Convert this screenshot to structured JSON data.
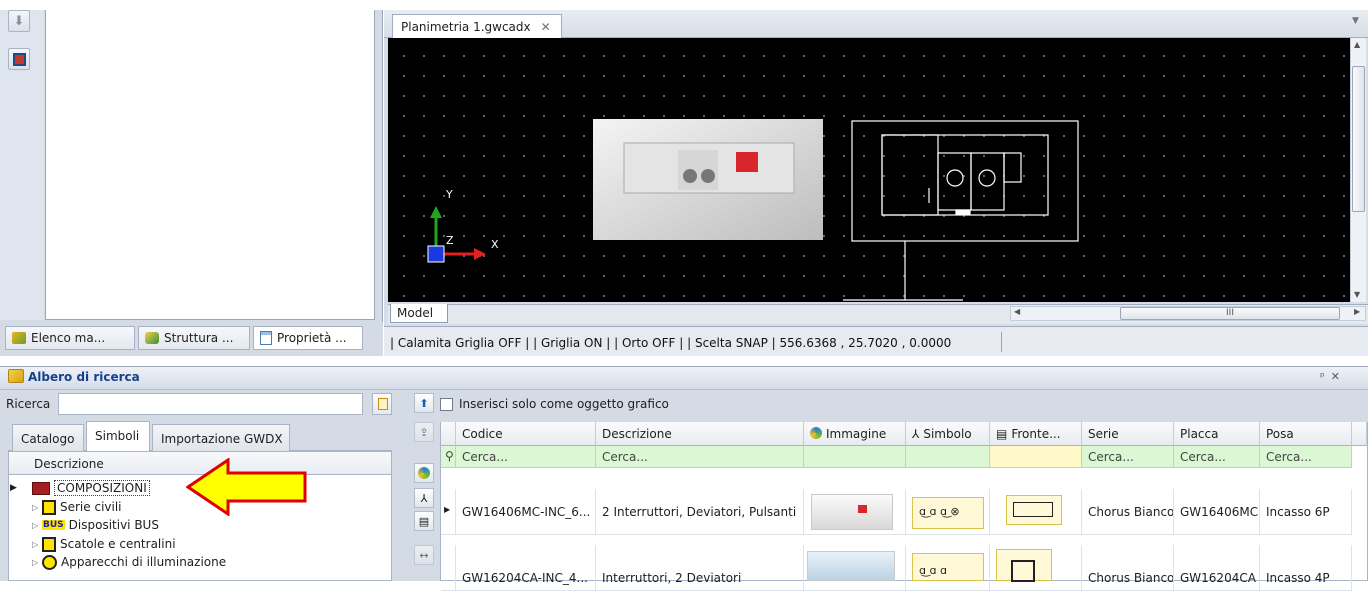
{
  "document": {
    "tab_title": "Planimetria 1.gwcadx",
    "model_tab": "Model",
    "scroll_label": "III",
    "axis_x": "X",
    "axis_y": "Y",
    "axis_z": "Z"
  },
  "status": {
    "text": "| Calamita Griglia OFF | | Griglia ON | | Orto OFF | | Scelta SNAP |   556.6368 , 25.7020 , 0.0000"
  },
  "left_tabs": [
    {
      "label": "Elenco ma...",
      "icon": "list-icon"
    },
    {
      "label": "Struttura ...",
      "icon": "structure-icon"
    },
    {
      "label": "Proprietà ...",
      "icon": "properties-icon"
    }
  ],
  "search_panel": {
    "title": "Albero di ricerca",
    "search_label": "Ricerca",
    "search_value": "",
    "tabs": [
      "Catalogo",
      "Simboli",
      "Importazione GWDX"
    ],
    "active_tab": "Simboli",
    "tree_header": "Descrizione",
    "tree_items": [
      {
        "label": "COMPOSIZIONI",
        "icon": "composition-icon",
        "selected": true
      },
      {
        "label": "Serie civili",
        "icon": "series-icon"
      },
      {
        "label": "Dispositivi BUS",
        "icon": "bus-icon",
        "badge": "BUS"
      },
      {
        "label": "Scatole e centralini",
        "icon": "box-icon"
      },
      {
        "label": "Apparecchi di illuminazione",
        "icon": "lamp-icon"
      }
    ]
  },
  "grid": {
    "checkbox_label": "Inserisci solo come oggetto grafico",
    "columns": [
      "Codice",
      "Descrizione",
      "Immagine",
      "Simbolo",
      "Fronte...",
      "Serie",
      "Placca",
      "Posa"
    ],
    "filter_placeholder": "Cerca...",
    "rows": [
      {
        "codice": "GW16406MC-INC_6...",
        "descrizione": "2 Interruttori, Deviatori, Pulsanti",
        "serie": "Chorus Bianco",
        "placca": "GW16406MC",
        "posa": "Incasso 6P",
        "symbol_text": "ɑ͜ ɑ ɑ͜ ⊗"
      },
      {
        "codice": "GW16204CA-INC_4...",
        "descrizione": "Interruttori, 2 Deviatori",
        "serie": "Chorus Bianco",
        "placca": "GW16204CA",
        "posa": "Incasso 4P",
        "symbol_text": "ɑ͜ ɑ ɑ"
      }
    ]
  },
  "colors": {
    "accent_arrow": "#ffff00",
    "arrow_border": "#e00000",
    "filter_row": "#dbf7d3",
    "symbol_cell": "#fff9d8"
  }
}
